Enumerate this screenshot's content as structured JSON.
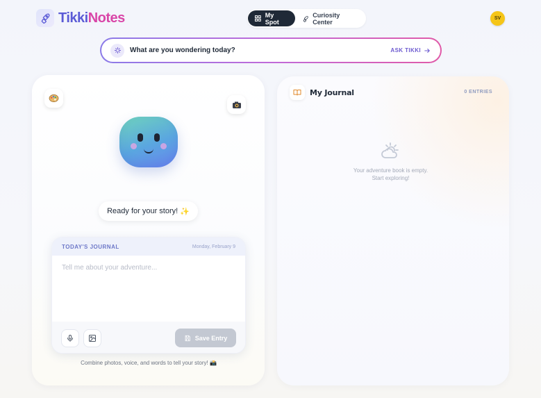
{
  "brand": {
    "part1": "Tikki",
    "part2": "Notes"
  },
  "nav": {
    "tabs": [
      {
        "label": "My Spot",
        "active": true,
        "icon": "grid-icon"
      },
      {
        "label": "Curiosity Center",
        "active": false,
        "icon": "rocket-icon"
      }
    ]
  },
  "user": {
    "initials": "SV"
  },
  "search": {
    "placeholder": "What are you wondering today?",
    "button": "ASK TIKKI"
  },
  "companion": {
    "status": "Ready for your story!",
    "status_emoji": "✨",
    "stickers": [
      "palette-icon",
      "camera-icon"
    ]
  },
  "journal": {
    "title": "TODAY'S JOURNAL",
    "date": "Monday, February 9",
    "placeholder": "Tell me about your adventure...",
    "save_label": "Save Entry",
    "hint": "Combine photos, voice, and words to tell your story! 📸"
  },
  "my_journal": {
    "title": "My Journal",
    "entries": "0 ENTRIES",
    "empty_line1": "Your adventure book is empty.",
    "empty_line2": "Start exploring!"
  },
  "colors": {
    "accent": "#5b5bd6",
    "brand_pink": "#d946a8",
    "nav_active": "#1f2937",
    "avatar": "#f5c518"
  }
}
